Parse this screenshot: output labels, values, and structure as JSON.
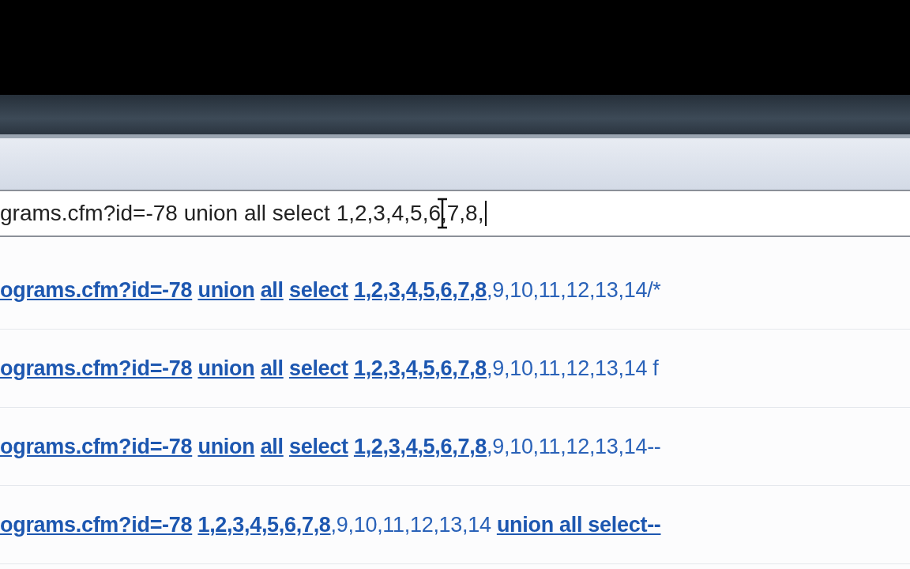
{
  "address_bar": {
    "value": "grams.cfm?id=-78 union all select 1,2,3,4,5,6,7,8,"
  },
  "suggestions": [
    {
      "text": "**ograms.cfm?id=-78** **union** **all** **select** **1,2,3,4,5,6,7,8**,9,10,11,12,13,14/*"
    },
    {
      "text": "**ograms.cfm?id=-78** **union** **all** **select** **1,2,3,4,5,6,7,8**,9,10,11,12,13,14 f"
    },
    {
      "text": "**ograms.cfm?id=-78** **union** **all** **select** **1,2,3,4,5,6,7,8**,9,10,11,12,13,14--"
    },
    {
      "text": "**ograms.cfm?id=-78** **1,2,3,4,5,6,7,8**,9,10,11,12,13,14 **union all select--**"
    }
  ]
}
